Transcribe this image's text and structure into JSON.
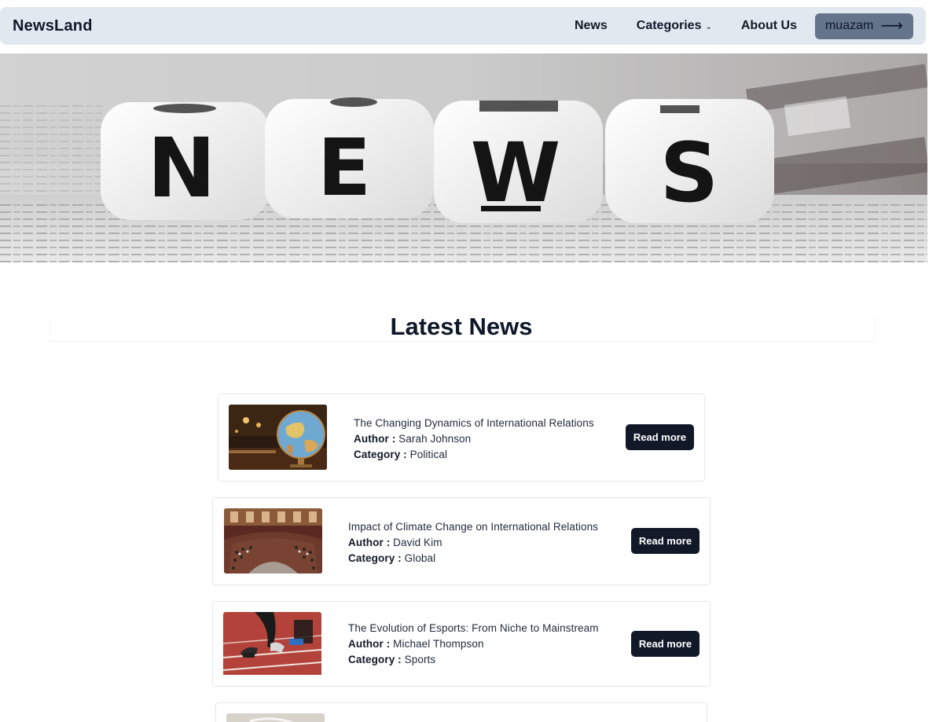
{
  "nav": {
    "brand": "NewsLand",
    "links": [
      {
        "label": "News"
      },
      {
        "label": "Categories",
        "has_dropdown": true
      },
      {
        "label": "About Us"
      }
    ],
    "user": {
      "label": "muazam",
      "icon": "arrow-right-icon"
    }
  },
  "hero": {
    "tiles": [
      "N",
      "E",
      "W",
      "S"
    ]
  },
  "section": {
    "title": "Latest News"
  },
  "labels": {
    "author": "Author :",
    "category": "Category :",
    "read_more": "Read more"
  },
  "articles": [
    {
      "title": "The Changing Dynamics of International Relations",
      "author": "Sarah Johnson",
      "category": "Political",
      "image": "globe-photo"
    },
    {
      "title": "Impact of Climate Change on International Relations",
      "author": "David Kim",
      "category": "Global",
      "image": "parliament-photo"
    },
    {
      "title": "The Evolution of Esports: From Niche to Mainstream",
      "author": "Michael Thompson",
      "category": "Sports",
      "image": "sprinter-photo"
    },
    {
      "title": "",
      "author": "",
      "category": "",
      "image": "partial-photo"
    }
  ],
  "colors": {
    "navbar": "#e2e8f0",
    "user_button": "#64748b",
    "read_button": "#111827"
  }
}
